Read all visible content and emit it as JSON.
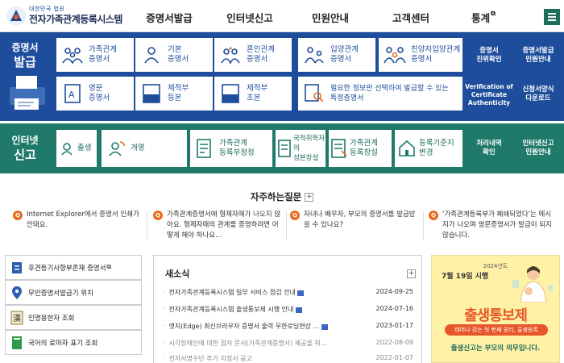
{
  "header": {
    "logo_sub": "대한민국 법원",
    "logo_main": "전자가족관계등록시스템",
    "menu": [
      "증명서발급",
      "인터넷신고",
      "민원안내",
      "고객센터",
      "통계"
    ]
  },
  "cert": {
    "side_small": "증명서",
    "side_big": "발급",
    "tiles": [
      {
        "label": "가족관계\n증명서",
        "icon": "family-icon"
      },
      {
        "label": "기본\n증명서",
        "icon": "person-icon"
      },
      {
        "label": "혼인관계\n증명서",
        "icon": "marriage-icon"
      },
      {
        "label": "입양관계\n증명서",
        "icon": "adoption-icon"
      },
      {
        "label": "친양자입양관계\n증명서",
        "icon": "family-adoption-icon"
      },
      {
        "label": "영문\n증명서",
        "icon": "english-doc-icon"
      },
      {
        "label": "제적부\n등본",
        "icon": "removed-register-icon"
      },
      {
        "label": "제적부\n초본",
        "icon": "removed-register-icon"
      },
      {
        "label": "필요한 정보만 선택하여 발급할 수 있는\n특정증명서",
        "icon": "search-doc-icon"
      }
    ],
    "right": [
      "증명서\n진위확인",
      "증명서발급\n민원안내",
      "Verification of\nCertificate\nAuthenticity",
      "신청서양식\n다운로드"
    ]
  },
  "report": {
    "side_small": "인터넷",
    "side_big": "신고",
    "tiles": [
      {
        "label": "출생",
        "icon": "baby-icon"
      },
      {
        "label": "개명",
        "icon": "rename-icon"
      },
      {
        "label": "가족관계\n등록부정정",
        "icon": "correction-icon"
      },
      {
        "label": "국적취득자의\n성본창설",
        "icon": "nationality-icon"
      },
      {
        "label": "가족관계\n등록창설",
        "icon": "registration-icon"
      },
      {
        "label": "등록기준지\n변경",
        "icon": "house-icon"
      }
    ],
    "right": [
      "처리내역\n확인",
      "인터넷신고\n민원안내"
    ]
  },
  "faq": {
    "title": "자주하는질문",
    "items": [
      "Internet Explorer에서 증명서 인쇄가 안돼요.",
      "가족관계증명서에 형제자매가 나오지 않아요. 형제자매의 관계를 증명하려면 어떻게 해야 하나요...",
      "자녀나 배우자, 부모의 증명서를 발급받을 수 있나요?",
      "'가족관계등록부가 폐쇄되었다'는 메시지가 나오며 영문증명서가 발급이 되지 않습니다."
    ]
  },
  "quick_links": [
    {
      "label": "후견등기사항부존재 증명서",
      "icon": "certificate-icon",
      "ext": true
    },
    {
      "label": "무인증명서발급기 위치",
      "icon": "location-icon",
      "ext": false
    },
    {
      "label": "인명용한자 조회",
      "icon": "hanja-icon",
      "ext": false
    },
    {
      "label": "국어의 로마자 표기 조회",
      "icon": "book-icon",
      "ext": false
    }
  ],
  "news": {
    "title": "새소식",
    "items": [
      {
        "title": "전자가족관계등록시스템 일부 서비스 점검 안내",
        "date": "2024-09-25",
        "new": true,
        "dim": false
      },
      {
        "title": "전자가족관계등록시스템 출생통보제 시행 안내",
        "date": "2024-07-16",
        "new": true,
        "dim": false
      },
      {
        "title": "엣지(Edge) 최신브라우저 증명서 출력 무한로딩현상 ...",
        "date": "2023-01-17",
        "new": true,
        "dim": false
      },
      {
        "title": "시각장애인에 대한 점자 문서(가족관계증명서) 제공을 위...",
        "date": "2022-08-09",
        "new": false,
        "dim": true
      },
      {
        "title": "전자서명수단 추가 지정서 공고",
        "date": "2022-01-07",
        "new": false,
        "dim": true
      }
    ]
  },
  "banner": {
    "line1": "2024년도",
    "line2": "7월 19일 시행",
    "big": "출생통보제",
    "pill": "태어나 갖는 첫 번째 권리, 출생등록",
    "foot": "출생신고는 부모의 의무입니다."
  },
  "colors": {
    "blue": "#1d4d9b",
    "green": "#1f7a6a",
    "orange": "#e86b1f"
  }
}
